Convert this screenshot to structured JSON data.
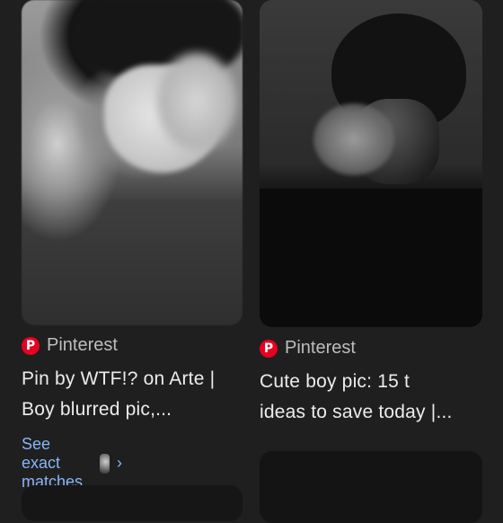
{
  "results": [
    {
      "source": "Pinterest",
      "title_line1": "Pin by WTF!? on Arte |",
      "title_line2": "Boy blurred pic,...",
      "see_matches": "See exact matches"
    },
    {
      "source": "Pinterest",
      "title_line1": "Cute boy pic: 15 t",
      "title_line2": "ideas to save today |..."
    }
  ],
  "icons": {
    "source_logo": "pinterest-icon",
    "chevron": "chevron-right-icon"
  },
  "colors": {
    "background": "#1f1f1f",
    "link": "#8ab4f8",
    "pinterest": "#e60023"
  }
}
